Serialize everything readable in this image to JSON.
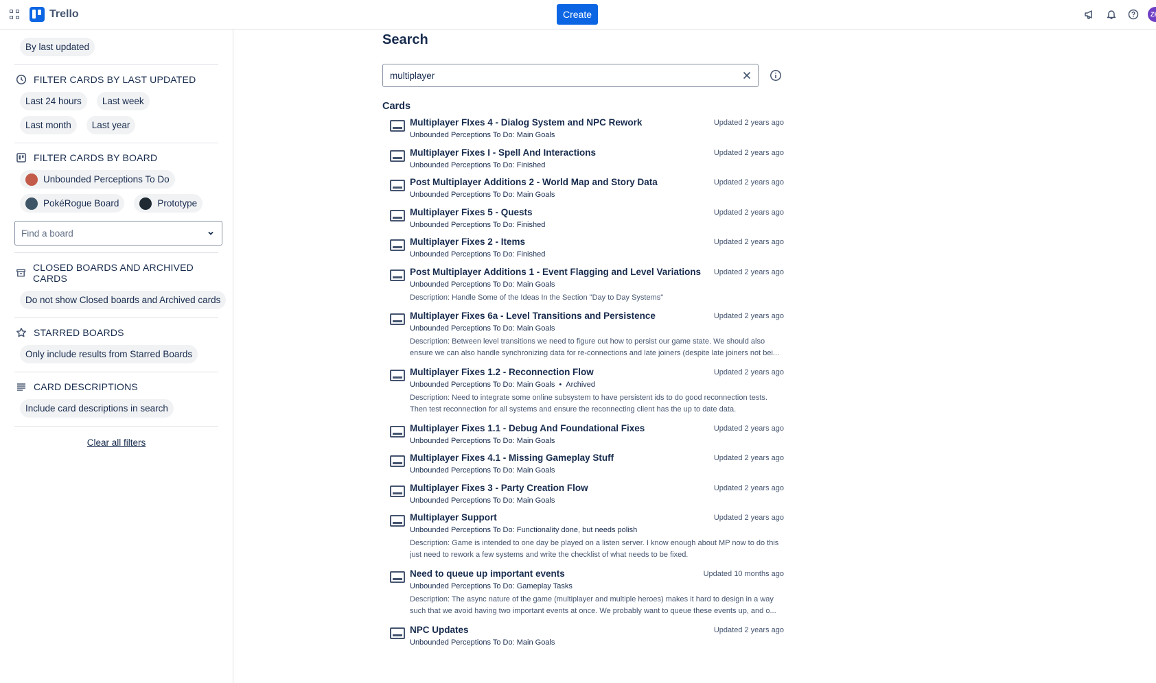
{
  "header": {
    "app_name": "Trello",
    "create_label": "Create",
    "avatar_initials": "ZH"
  },
  "sidebar": {
    "sort_chip": "By last updated",
    "last_updated": {
      "title": "FILTER CARDS BY LAST UPDATED",
      "options": [
        "Last 24 hours",
        "Last week",
        "Last month",
        "Last year"
      ]
    },
    "board_filter": {
      "title": "FILTER CARDS BY BOARD",
      "boards": [
        {
          "label": "Unbounded Perceptions To Do",
          "color": "#c25b4a"
        },
        {
          "label": "PokéRogue Board",
          "color": "#3d5566"
        },
        {
          "label": "Prototype",
          "color": "#1f2a33"
        }
      ],
      "find_placeholder": "Find a board"
    },
    "closed": {
      "title": "CLOSED BOARDS AND ARCHIVED CARDS",
      "chip": "Do not show Closed boards and Archived cards"
    },
    "starred": {
      "title": "STARRED BOARDS",
      "chip": "Only include results from Starred Boards"
    },
    "descriptions": {
      "title": "CARD DESCRIPTIONS",
      "chip": "Include card descriptions in search"
    },
    "clear_label": "Clear all filters"
  },
  "main": {
    "title": "Search",
    "query": "multiplayer",
    "cards_heading": "Cards",
    "cards": [
      {
        "title": "Multiplayer FIxes 4 - Dialog System and NPC Rework",
        "sub": "Unbounded Perceptions To Do: Main Goals",
        "updated": "Updated 2 years ago"
      },
      {
        "title": "Multiplayer Fixes I - Spell And Interactions",
        "sub": "Unbounded Perceptions To Do: Finished",
        "updated": "Updated 2 years ago"
      },
      {
        "title": "Post Multiplayer Additions 2 - World Map and Story Data",
        "sub": "Unbounded Perceptions To Do: Main Goals",
        "updated": "Updated 2 years ago"
      },
      {
        "title": "Multiplayer Fixes 5 - Quests",
        "sub": "Unbounded Perceptions To Do: Finished",
        "updated": "Updated 2 years ago"
      },
      {
        "title": "Multiplayer Fixes 2 - Items",
        "sub": "Unbounded Perceptions To Do: Finished",
        "updated": "Updated 2 years ago"
      },
      {
        "title": "Post Multiplayer Additions 1 - Event Flagging and Level Variations",
        "sub": "Unbounded Perceptions To Do: Main Goals",
        "updated": "Updated 2 years ago",
        "desc": "Description: Handle Some of the Ideas In the Section \"Day to Day Systems\""
      },
      {
        "title": "Multiplayer Fixes 6a - Level Transitions and Persistence",
        "sub": "Unbounded Perceptions To Do: Main Goals",
        "updated": "Updated 2 years ago",
        "desc": "Description: Between level transitions we need to figure out how to persist our game state. We should also ensure we can also handle synchronizing data for re-connections and late joiners (despite late joiners not bei..."
      },
      {
        "title": "Multiplayer Fixes 1.2 - Reconnection Flow",
        "sub": "Unbounded Perceptions To Do: Main Goals",
        "extra": "Archived",
        "updated": "Updated 2 years ago",
        "desc": "Description: Need to integrate some online subsystem to have persistent ids to do good reconnection tests. Then test reconnection for all systems and ensure the reconnecting client has the up to date data."
      },
      {
        "title": "Multiplayer Fixes 1.1 - Debug And Foundational Fixes",
        "sub": "Unbounded Perceptions To Do: Main Goals",
        "updated": "Updated 2 years ago"
      },
      {
        "title": "Multiplayer Fixes 4.1 - Missing Gameplay Stuff",
        "sub": "Unbounded Perceptions To Do: Main Goals",
        "updated": "Updated 2 years ago"
      },
      {
        "title": "Multiplayer Fixes 3 - Party Creation Flow",
        "sub": "Unbounded Perceptions To Do: Main Goals",
        "updated": "Updated 2 years ago"
      },
      {
        "title": "Multiplayer Support",
        "sub": "Unbounded Perceptions To Do: Functionality done, but needs polish",
        "updated": "Updated 2 years ago",
        "desc": "Description: Game is intended to one day be played on a listen server. I know enough about MP now to do this just need to rework a few systems and write the checklist of what needs to be fixed."
      },
      {
        "title": "Need to queue up important events",
        "sub": "Unbounded Perceptions To Do: Gameplay Tasks",
        "updated": "Updated 10 months ago",
        "desc": "Description: The async nature of the game (multiplayer and multiple heroes) makes it hard to design in a way such that we avoid having two important events at once. We probably want to queue these events up, and o..."
      },
      {
        "title": "NPC Updates",
        "sub": "Unbounded Perceptions To Do: Main Goals",
        "updated": "Updated 2 years ago"
      }
    ]
  }
}
